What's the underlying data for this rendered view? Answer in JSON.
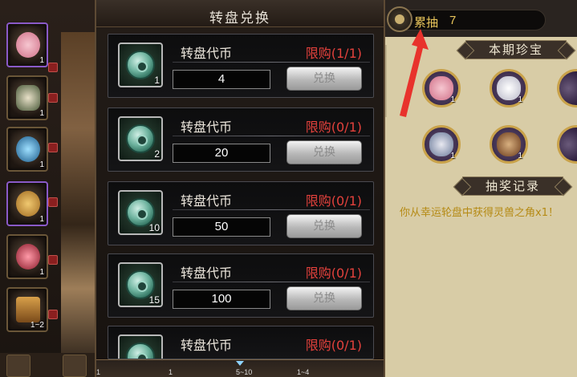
{
  "panel": {
    "title": "转盘兑换",
    "items": [
      {
        "name": "转盘代币",
        "limit": "限购(1/1)",
        "qty": "1",
        "value": "4",
        "button": "兑换"
      },
      {
        "name": "转盘代币",
        "limit": "限购(0/1)",
        "qty": "2",
        "value": "20",
        "button": "兑换"
      },
      {
        "name": "转盘代币",
        "limit": "限购(0/1)",
        "qty": "10",
        "value": "50",
        "button": "兑换"
      },
      {
        "name": "转盘代币",
        "limit": "限购(0/1)",
        "qty": "15",
        "value": "100",
        "button": "兑换"
      },
      {
        "name": "转盘代币",
        "limit": "限购(0/1)"
      }
    ]
  },
  "accumulated": {
    "label": "累抽",
    "count": "7"
  },
  "treasures": {
    "header": "本期珍宝",
    "items": [
      {
        "icon": "pig-icon",
        "qty": "1"
      },
      {
        "icon": "rabbit-icon",
        "qty": "1"
      },
      {
        "icon": "goat-icon",
        "qty": "1"
      },
      {
        "icon": "ox-icon",
        "qty": "1"
      }
    ]
  },
  "record": {
    "header": "抽奖记录",
    "line": "你从幸运轮盘中获得灵兽之角x1！"
  },
  "left_grid": {
    "counts": [
      "1",
      "1",
      "1",
      "1",
      "1",
      "1~2"
    ],
    "strip_counts": [
      "1",
      "1",
      "5~10",
      "1~4"
    ]
  },
  "colors": {
    "limit_red": "#e3413c",
    "accum_gold": "#e8c45a",
    "record_text": "#b58a14",
    "arrow_red": "#e8322c"
  }
}
